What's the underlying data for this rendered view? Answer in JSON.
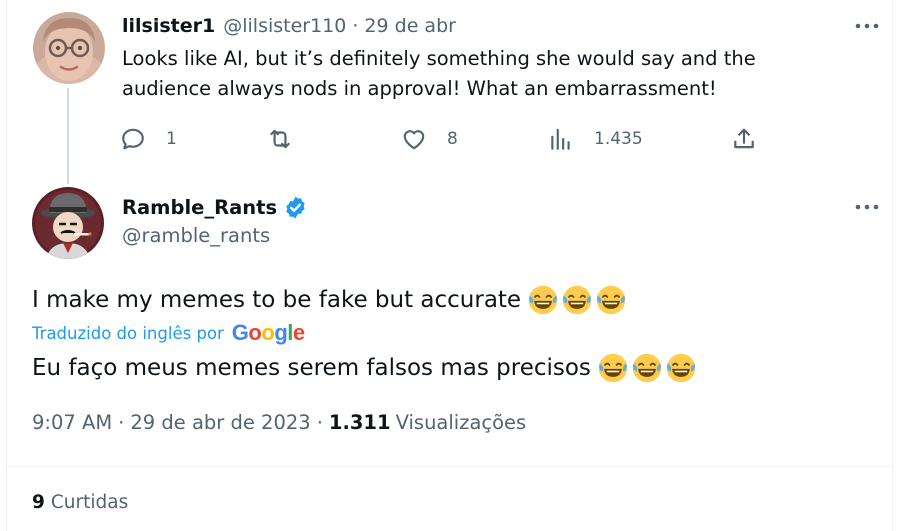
{
  "reply": {
    "name": "lilsister1",
    "handle": "@lilsister110",
    "separator": "·",
    "date": "29 de abr",
    "text": "Looks like AI, but it’s definitely something she would say and the audience always nods in approval! What an embarrassment!",
    "actions": {
      "replies": "1",
      "retweets": "",
      "likes": "8",
      "views": "1.435"
    }
  },
  "tweet": {
    "name": "Ramble_Rants",
    "handle": "@ramble_rants",
    "text": "I make my memes to be fake but accurate",
    "translated_label": "Traduzido do inglês por",
    "translation_provider": "Google",
    "translated_text": "Eu faço meus memes serem falsos mas precisos",
    "emoji": "face-with-tears-of-joy",
    "emoji_count": 3,
    "time": "9:07 AM",
    "separator": "·",
    "date": "29 de abr de 2023",
    "views_count": "1.311",
    "views_label": "Visualizações"
  },
  "engagement": {
    "likes_count": "9",
    "likes_label": "Curtidas"
  },
  "colors": {
    "primary_text": "#0f1419",
    "secondary_text": "#536471",
    "accent": "#1d9bf0",
    "border": "#eff3f4",
    "thread_line": "#cfd9de"
  },
  "icons": [
    "more-icon",
    "reply-icon",
    "retweet-icon",
    "like-icon",
    "views-icon",
    "share-icon",
    "verified-badge-icon",
    "laugh-emoji-icon"
  ]
}
